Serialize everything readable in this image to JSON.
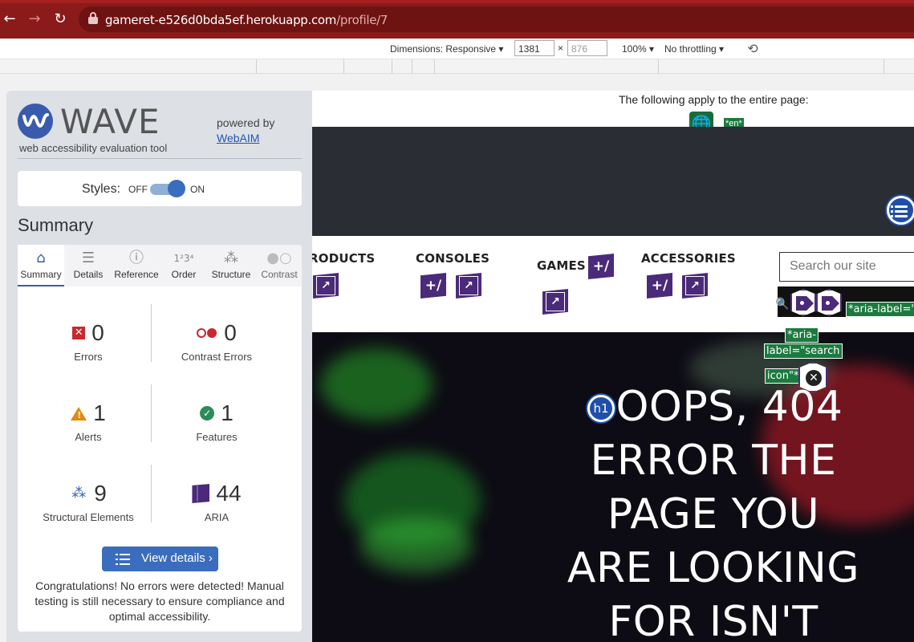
{
  "browser": {
    "url_host": "gameret-e526d0bda5ef.herokuapp.com",
    "url_path": "/profile/7",
    "back_icon": "arrow-left-icon",
    "forward_icon": "arrow-right-icon",
    "reload_icon": "reload-icon"
  },
  "devtools": {
    "dimensions_label": "Dimensions: Responsive",
    "width": "1381",
    "height_placeholder": "876",
    "times": "×",
    "zoom": "100%",
    "throttling": "No throttling"
  },
  "page": {
    "entire_page_note": "The following apply to the entire page:",
    "lang_tag": "*en*",
    "nav": [
      "RODUCTS",
      "CONSOLES",
      "GAMES",
      "ACCESSORIES"
    ],
    "search_placeholder": "Search our site",
    "aria_label_1": "*aria-label=\"s",
    "aria_label_2a": "*aria-",
    "aria_label_2b": "label=\"search",
    "aria_label_2c": "icon\"*",
    "h1_badge": "h1",
    "hero_lines": [
      "OOPS, 404",
      "ERROR THE",
      "PAGE YOU",
      "ARE LOOKING",
      "FOR ISN'T"
    ]
  },
  "wave": {
    "brand": "WAVE",
    "tagline": "web accessibility evaluation tool",
    "powered_by": "powered by",
    "webaim": "WebAIM",
    "styles_label": "Styles:",
    "off": "OFF",
    "on": "ON",
    "summary_heading": "Summary",
    "tabs": [
      {
        "label": "Summary",
        "icon": "home-icon"
      },
      {
        "label": "Details",
        "icon": "list-icon"
      },
      {
        "label": "Reference",
        "icon": "info-icon"
      },
      {
        "label": "Order",
        "icon": "order-icon"
      },
      {
        "label": "Structure",
        "icon": "structure-icon"
      },
      {
        "label": "Contrast",
        "icon": "contrast-icon"
      }
    ],
    "metrics": {
      "errors": {
        "value": "0",
        "label": "Errors"
      },
      "contrast_errors": {
        "value": "0",
        "label": "Contrast Errors"
      },
      "alerts": {
        "value": "1",
        "label": "Alerts"
      },
      "features": {
        "value": "1",
        "label": "Features"
      },
      "structural": {
        "value": "9",
        "label": "Structural Elements"
      },
      "aria": {
        "value": "44",
        "label": "ARIA"
      }
    },
    "view_details": "View details ›",
    "congrats": "Congratulations! No errors were detected! Manual testing is still necessary to ensure compliance and optimal accessibility."
  },
  "colors": {
    "browser_bar": "#8b1a1a",
    "wave_blue": "#3a5bad",
    "aria_purple": "#4b2a7a",
    "error_red": "#c8282f",
    "alert_orange": "#e08b12",
    "feature_green": "#2e8b57"
  }
}
